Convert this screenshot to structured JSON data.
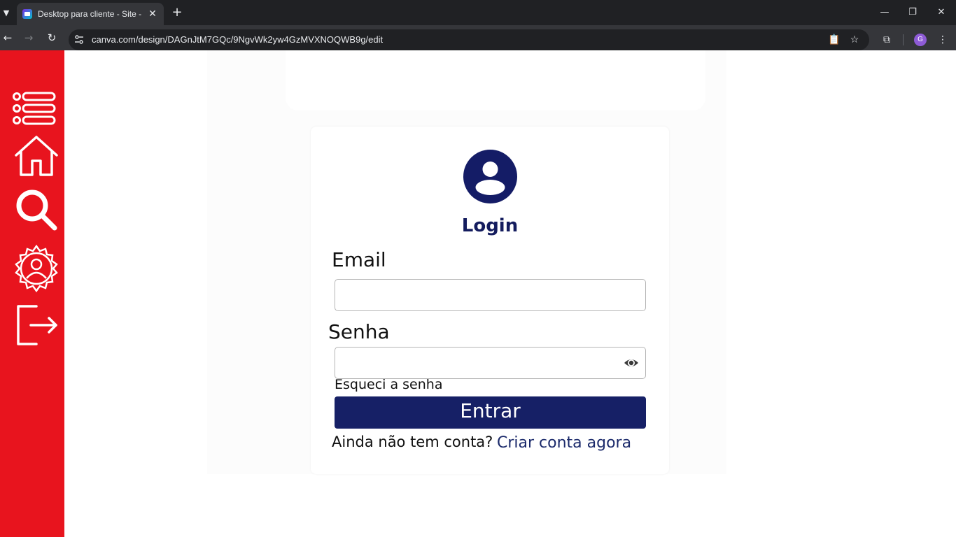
{
  "browser": {
    "tab_title": "Desktop para cliente - Site - Canva",
    "url": "canva.com/design/DAGnJtM7GQc/9NgvWk2yw4GzMVXNOQWB9g/edit",
    "profile_initial": "G"
  },
  "sidebar": {
    "color": "#e8141e",
    "items": [
      {
        "icon": "menu-list-icon"
      },
      {
        "icon": "home-icon"
      },
      {
        "icon": "search-icon"
      },
      {
        "icon": "settings-user-icon"
      },
      {
        "icon": "logout-icon"
      }
    ]
  },
  "login": {
    "title": "Login",
    "email_label": "Email",
    "email_value": "",
    "password_label": "Senha",
    "password_value": "",
    "forgot_password": "Esqueci a senha",
    "submit_label": "Entrar",
    "no_account_text": "Ainda não tem conta?",
    "create_account_link": "Criar conta agora",
    "accent_color": "#162066"
  }
}
